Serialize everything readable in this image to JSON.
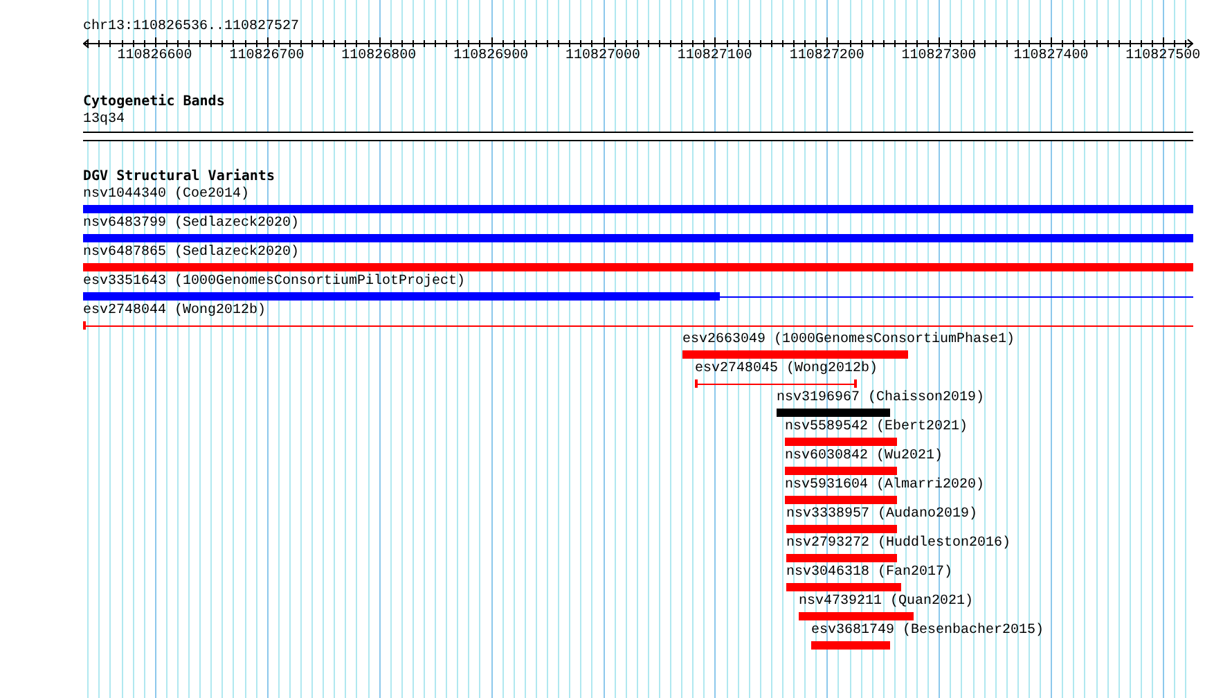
{
  "location": "chr13:110826536..110827527",
  "ruler": {
    "tick_labels": [
      "110826600",
      "110826700",
      "110826800",
      "110826900",
      "110827000",
      "110827100",
      "110827200",
      "110827300",
      "110827400",
      "110827500"
    ]
  },
  "tracks": [
    {
      "title": "Cytogenetic Bands",
      "kind": "bands",
      "band_label": "13q34"
    },
    {
      "title": "DGV Structural Variants",
      "kind": "variants",
      "features": [
        {
          "label": "nsv1044340 (Coe2014)",
          "color": "#0000ff",
          "parts": [
            {
              "kind": "thick"
            }
          ]
        },
        {
          "label": "nsv6483799 (Sedlazeck2020)",
          "color": "#0000ff",
          "parts": [
            {
              "kind": "thick"
            }
          ]
        },
        {
          "label": "nsv6487865 (Sedlazeck2020)",
          "color": "#ff0000",
          "parts": [
            {
              "kind": "thick"
            }
          ]
        },
        {
          "label": "esv3351643 (1000GenomesConsortiumPilotProject)",
          "color": "#0000ff",
          "parts": [
            {
              "kind": "thick"
            },
            {
              "kind": "thin"
            }
          ]
        },
        {
          "label": "esv2748044 (Wong2012b)",
          "color": "#ff0000",
          "parts": [
            {
              "kind": "thick"
            },
            {
              "kind": "thin"
            }
          ]
        },
        {
          "label": "esv2663049 (1000GenomesConsortiumPhase1)",
          "color": "#ff0000",
          "parts": [
            {
              "kind": "thick"
            }
          ]
        },
        {
          "label": "esv2748045 (Wong2012b)",
          "color": "#ff0000",
          "parts": [
            {
              "kind": "capped"
            }
          ]
        },
        {
          "label": "nsv3196967 (Chaisson2019)",
          "color": "#000000",
          "parts": [
            {
              "kind": "thick"
            }
          ]
        },
        {
          "label": "nsv5589542 (Ebert2021)",
          "color": "#ff0000",
          "parts": [
            {
              "kind": "thick"
            }
          ]
        },
        {
          "label": "nsv6030842 (Wu2021)",
          "color": "#ff0000",
          "parts": [
            {
              "kind": "thick"
            }
          ]
        },
        {
          "label": "nsv5931604 (Almarri2020)",
          "color": "#ff0000",
          "parts": [
            {
              "kind": "thick"
            }
          ]
        },
        {
          "label": "nsv3338957 (Audano2019)",
          "color": "#ff0000",
          "parts": [
            {
              "kind": "thick"
            }
          ]
        },
        {
          "label": "nsv2793272 (Huddleston2016)",
          "color": "#ff0000",
          "parts": [
            {
              "kind": "thick"
            }
          ]
        },
        {
          "label": "nsv3046318 (Fan2017)",
          "color": "#ff0000",
          "parts": [
            {
              "kind": "thick"
            }
          ]
        },
        {
          "label": "nsv4739211 (Quan2021)",
          "color": "#ff0000",
          "parts": [
            {
              "kind": "thick"
            }
          ]
        },
        {
          "label": "esv3681749 (Besenbacher2015)",
          "color": "#ff0000",
          "parts": [
            {
              "kind": "thick"
            }
          ]
        }
      ]
    }
  ]
}
